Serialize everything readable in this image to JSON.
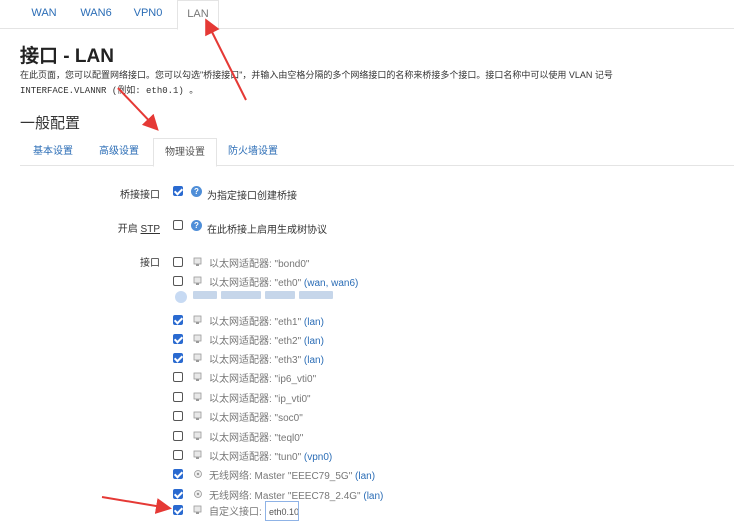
{
  "top_tabs": [
    "WAN",
    "WAN6",
    "VPN0",
    "LAN"
  ],
  "page_title": "接口 - LAN",
  "description_line1": "在此页面，您可以配置网络接口。您可以勾选\"桥接接口\"，并输入由空格分隔的多个网络接口的名称来桥接多个接口。接口名称中可以使用 VLAN 记号",
  "description_line2": "INTERFACE.VLANNR (例如: eth0.1) 。",
  "section_title": "一般配置",
  "sub_tabs": [
    "基本设置",
    "高级设置",
    "物理设置",
    "防火墙设置"
  ],
  "bridge": {
    "label": "桥接接口",
    "checked": true,
    "help": "为指定接口创建桥接"
  },
  "stp": {
    "label_prefix": "开启 ",
    "label_abbr": "STP",
    "checked": false,
    "help": "在此桥接上启用生成树协议"
  },
  "interfaces": {
    "label": "接口",
    "items": [
      {
        "checked": false,
        "text": "以太网适配器: \"bond0\"",
        "networks": "",
        "icon": "ethernet-adapter-icon"
      },
      {
        "checked": false,
        "text": "以太网适配器: \"eth0\"",
        "networks": "(wan, wan6)",
        "icon": "ethernet-adapter-icon"
      },
      {
        "checked": true,
        "text": "以太网适配器: \"eth1\"",
        "networks": "(lan)",
        "icon": "ethernet-adapter-icon"
      },
      {
        "checked": true,
        "text": "以太网适配器: \"eth2\"",
        "networks": "(lan)",
        "icon": "ethernet-adapter-icon"
      },
      {
        "checked": true,
        "text": "以太网适配器: \"eth3\"",
        "networks": "(lan)",
        "icon": "ethernet-adapter-icon"
      },
      {
        "checked": false,
        "text": "以太网适配器: \"ip6_vti0\"",
        "networks": "",
        "icon": "ethernet-adapter-icon"
      },
      {
        "checked": false,
        "text": "以太网适配器: \"ip_vti0\"",
        "networks": "",
        "icon": "ethernet-adapter-icon"
      },
      {
        "checked": false,
        "text": "以太网适配器: \"soc0\"",
        "networks": "",
        "icon": "ethernet-adapter-icon"
      },
      {
        "checked": false,
        "text": "以太网适配器: \"teql0\"",
        "networks": "",
        "icon": "ethernet-adapter-icon"
      },
      {
        "checked": false,
        "text": "以太网适配器: \"tun0\"",
        "networks": "(vpn0)",
        "icon": "ethernet-adapter-icon"
      },
      {
        "checked": true,
        "text": "无线网络: Master \"EEEC79_5G\"",
        "networks": "(lan)",
        "icon": "wireless-icon"
      },
      {
        "checked": true,
        "text": "无线网络: Master \"EEEC78_2.4G\"",
        "networks": "(lan)",
        "icon": "wireless-icon"
      }
    ],
    "custom": {
      "checked": true,
      "label": "自定义接口:",
      "value": "eth0.10"
    }
  },
  "colors": {
    "link": "#2b6db6",
    "checkbox": "#2a6ad0",
    "annotation_arrow": "#e53935"
  }
}
